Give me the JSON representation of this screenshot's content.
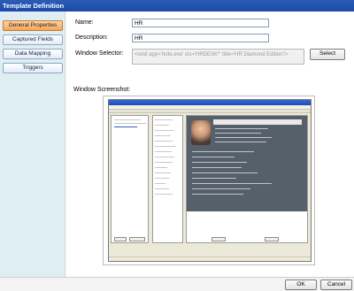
{
  "window": {
    "title": "Template Definition"
  },
  "nav": {
    "items": [
      {
        "label": "General Properties",
        "active": true
      },
      {
        "label": "Captured Fields",
        "active": false
      },
      {
        "label": "Data Mapping",
        "active": false
      },
      {
        "label": "Triggers",
        "active": false
      }
    ]
  },
  "form": {
    "name_label": "Name:",
    "name_value": "HR",
    "description_label": "Description:",
    "description_value": "HR",
    "window_selector_label": "Window Selector:",
    "window_selector_value": "<wnd app='hrde.exe' cls='HRDESK*' title='HR Diamond Edition'/>",
    "select_button": "Select",
    "window_screenshot_label": "Window Screenshot:"
  },
  "screenshot": {
    "window_title": "Employee Maintenance",
    "employee_name": "Jenny Thompson",
    "menu_items": [
      "File",
      "Employee",
      "Find",
      "Format",
      "Options",
      "Help"
    ],
    "left_list": [
      "HR Services",
      "HR Technical Services",
      "John Smith"
    ],
    "mid_list": [
      "Personal",
      "Address",
      "Dependents",
      "Awards",
      "Benefits",
      "Certifications",
      "Education",
      "Experience",
      "Evaluations",
      "Jobs",
      "Training",
      "Health",
      "Visa",
      "Salary",
      "Education"
    ],
    "left_buttons": [
      "Add",
      "Remove"
    ],
    "card_buttons": [
      "OK",
      "Edit"
    ]
  },
  "footer": {
    "ok_label": "OK",
    "cancel_label": "Cancel"
  }
}
